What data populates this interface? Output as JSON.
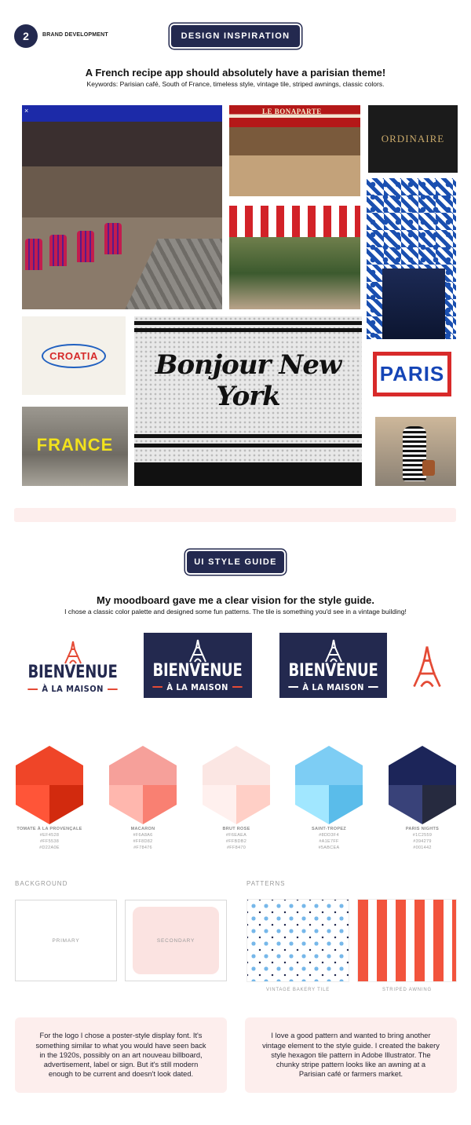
{
  "header": {
    "step_number": "2",
    "step_label": "BRAND DEVELOPMENT"
  },
  "design_inspiration": {
    "pill": "DESIGN INSPIRATION",
    "heading": "A French recipe app should absolutely have a parisian theme!",
    "keywords": "Keywords: Parisian café, South of France, timeless style, vintage tile, striped awnings, classic colors.",
    "moodboard": {
      "close": "×",
      "bonaparte_sign": "LE BONAPARTE",
      "ordinaire": "ORDINAIRE",
      "croatia": "CROATIA",
      "bonjour": "Bonjour New York",
      "paris": "PARIS",
      "france": "FRANCE"
    }
  },
  "style_guide": {
    "pill": "UI STYLE GUIDE",
    "heading": "My moodboard gave me a clear vision for the style guide.",
    "subheading": "I chose a classic color palette and designed some fun patterns. The tile is something you'd see in a vintage building!",
    "logo": {
      "word": "BIENVENUE",
      "tagline": "À LA MAISON"
    },
    "colors": [
      {
        "name": "TOMATE À LA PROVENÇALE",
        "codes": [
          "#EF4528",
          "#FF5538",
          "#D22A0E"
        ],
        "top": "#ef4528",
        "left": "#ff5538",
        "right": "#d22a0e"
      },
      {
        "name": "MACARON",
        "codes": [
          "#F6A8A6",
          "#FF8D82",
          "#F78476"
        ],
        "top": "#f6a09a",
        "left": "#ffb7ae",
        "right": "#f98072"
      },
      {
        "name": "BRUT ROSE",
        "codes": [
          "#F6EAEA",
          "#FFBDB2",
          "#FF8470"
        ],
        "top": "#fbe6e3",
        "left": "#fff0ee",
        "right": "#ffcfc6"
      },
      {
        "name": "SAINT-TROPEZ",
        "codes": [
          "#8DD3F4",
          "#A1E7FF",
          "#5ABCEA"
        ],
        "top": "#7dcdf4",
        "left": "#a1e7ff",
        "right": "#5abcea"
      },
      {
        "name": "PARIS NIGHTS",
        "codes": [
          "#1C2559",
          "#394279",
          "#001442"
        ],
        "top": "#1c2559",
        "left": "#394279",
        "right": "#262a3f"
      }
    ],
    "background": {
      "label": "BACKGROUND",
      "primary": "PRIMARY",
      "secondary": "SECONDARY"
    },
    "patterns": {
      "label": "PATTERNS",
      "tile_caption": "VINTAGE BAKERY TILE",
      "stripe_caption": "STRIPED AWNING"
    },
    "notes": {
      "logo": "For the logo I chose a poster-style display font. It's something similar to what you would have seen back in the 1920s, possibly on an art nouveau billboard, advertisement, label or sign. But it's still modern enough to be current and doesn't look dated.",
      "pattern": "I love a good pattern and wanted to bring another vintage element to the style guide. I created the bakery style hexagon tile pattern in Adobe Illustrator. The chunky stripe pattern looks like an awning at a Parisian café or farmers market."
    }
  },
  "colors": {
    "navy": "#23294f",
    "accent": "#e44a35",
    "pink": "#fdeeed"
  }
}
